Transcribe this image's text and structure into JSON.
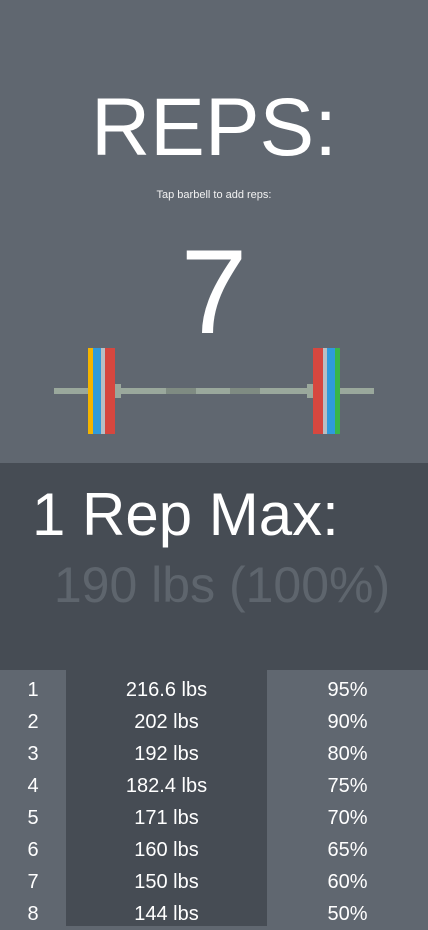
{
  "reps": {
    "title": "REPS:",
    "instruction": "Tap barbell to add reps:",
    "count": "7"
  },
  "barbell": {
    "icon": "barbell-icon",
    "plate_colors": [
      "#f4b400",
      "#2f9bdc",
      "#d6473f",
      "#39b54a"
    ],
    "bar_color": "#9aa89c"
  },
  "max": {
    "label": "1 Rep Max:",
    "value": "190 lbs (100%)"
  },
  "table": {
    "rows": [
      {
        "rep": "1",
        "weight": "216.6 lbs",
        "percent": "95%"
      },
      {
        "rep": "2",
        "weight": "202 lbs",
        "percent": "90%"
      },
      {
        "rep": "3",
        "weight": "192 lbs",
        "percent": "80%"
      },
      {
        "rep": "4",
        "weight": "182.4 lbs",
        "percent": "75%"
      },
      {
        "rep": "5",
        "weight": "171 lbs",
        "percent": "70%"
      },
      {
        "rep": "6",
        "weight": "160 lbs",
        "percent": "65%"
      },
      {
        "rep": "7",
        "weight": "150 lbs",
        "percent": "60%"
      },
      {
        "rep": "8",
        "weight": "144 lbs",
        "percent": "50%"
      }
    ]
  },
  "colors": {
    "top_bg": "#606770",
    "bottom_bg": "#464c54",
    "muted_text": "#5e656d"
  }
}
